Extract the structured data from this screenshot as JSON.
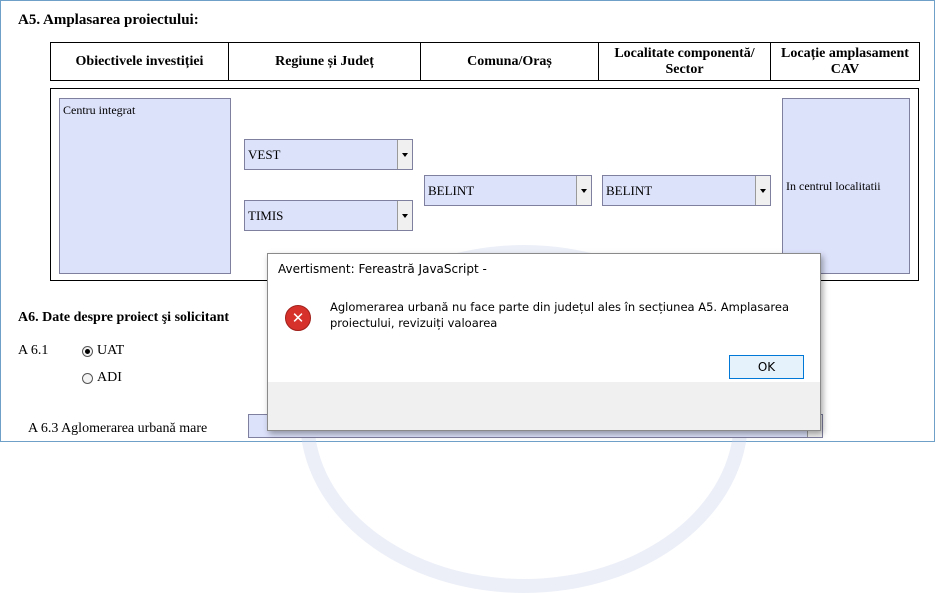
{
  "sections": {
    "a5_title": "A5. Amplasarea proiectului:",
    "a6_title": "A6. Date despre proiect şi solicitant",
    "a61_label": "A 6.1",
    "a63_label": "A 6.3 Aglomerarea urbană mare"
  },
  "table": {
    "headers": [
      "Obiectivele investiției",
      "Regiune și Județ",
      "Comuna/Oraș",
      "Localitate componentă/ Sector",
      "Locație amplasament CAV"
    ],
    "objective_value": "Centru integrat",
    "region_value": "VEST",
    "county_value": "TIMIS",
    "commune_value": "BELINT",
    "locality_value": "BELINT",
    "cav_value": "In centrul localitatii"
  },
  "radios": {
    "uat_label": "UAT",
    "adi_label": "ADI",
    "uat_checked": true,
    "adi_checked": false
  },
  "dialog": {
    "title": "Avertisment: Fereastră JavaScript -",
    "message": "Aglomerarea urbană nu face parte din județul ales în secțiunea A5. Amplasarea proiectului, revizuiți valoarea",
    "ok_label": "OK",
    "icon": "error-icon"
  },
  "colors": {
    "field_bg": "#dde2fb",
    "error_red": "#d6312b",
    "button_border": "#0078d7"
  }
}
